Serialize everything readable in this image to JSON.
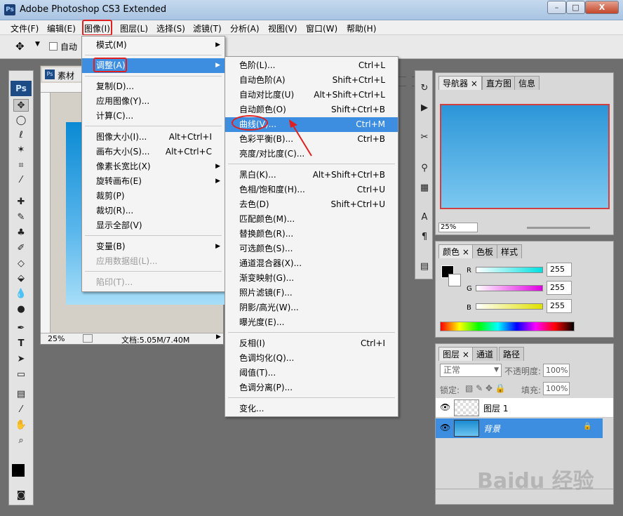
{
  "window": {
    "title": "Adobe Photoshop CS3 Extended",
    "minimize": "–",
    "maximize": "□",
    "close": "X"
  },
  "menubar": [
    "文件(F)",
    "编辑(E)",
    "图像(I)",
    "图层(L)",
    "选择(S)",
    "滤镜(T)",
    "分析(A)",
    "视图(V)",
    "窗口(W)",
    "帮助(H)"
  ],
  "options": {
    "auto_select": "自动",
    "ps_icon": "Ps"
  },
  "document": {
    "tab": "素材",
    "zoom": "25%",
    "filesize": "文档:5.05M/7.40M"
  },
  "image_menu": {
    "items": [
      {
        "label": "模式(M)",
        "sub": true
      },
      {
        "label": "调整(A)",
        "sub": true,
        "highlight": true
      },
      {
        "label": "复制(D)..."
      },
      {
        "label": "应用图像(Y)..."
      },
      {
        "label": "计算(C)..."
      },
      {
        "label": "图像大小(I)...",
        "shortcut": "Alt+Ctrl+I"
      },
      {
        "label": "画布大小(S)...",
        "shortcut": "Alt+Ctrl+C"
      },
      {
        "label": "像素长宽比(X)",
        "sub": true
      },
      {
        "label": "旋转画布(E)",
        "sub": true
      },
      {
        "label": "裁剪(P)"
      },
      {
        "label": "裁切(R)..."
      },
      {
        "label": "显示全部(V)"
      },
      {
        "label": "变量(B)",
        "sub": true
      },
      {
        "label": "应用数据组(L)...",
        "disabled": true
      },
      {
        "label": "陷印(T)...",
        "disabled": true
      }
    ]
  },
  "adjust_menu": {
    "items": [
      {
        "label": "色阶(L)...",
        "shortcut": "Ctrl+L"
      },
      {
        "label": "自动色阶(A)",
        "shortcut": "Shift+Ctrl+L"
      },
      {
        "label": "自动对比度(U)",
        "shortcut": "Alt+Shift+Ctrl+L"
      },
      {
        "label": "自动颜色(O)",
        "shortcut": "Shift+Ctrl+B"
      },
      {
        "label": "曲线(V)...",
        "shortcut": "Ctrl+M",
        "highlight": true
      },
      {
        "label": "色彩平衡(B)...",
        "shortcut": "Ctrl+B"
      },
      {
        "label": "亮度/对比度(C)..."
      },
      {
        "label": "黑白(K)...",
        "shortcut": "Alt+Shift+Ctrl+B"
      },
      {
        "label": "色相/饱和度(H)...",
        "shortcut": "Ctrl+U"
      },
      {
        "label": "去色(D)",
        "shortcut": "Shift+Ctrl+U"
      },
      {
        "label": "匹配颜色(M)..."
      },
      {
        "label": "替换颜色(R)..."
      },
      {
        "label": "可选颜色(S)..."
      },
      {
        "label": "通道混合器(X)..."
      },
      {
        "label": "渐变映射(G)..."
      },
      {
        "label": "照片滤镜(F)..."
      },
      {
        "label": "阴影/高光(W)..."
      },
      {
        "label": "曝光度(E)..."
      },
      {
        "label": "反相(I)",
        "shortcut": "Ctrl+I"
      },
      {
        "label": "色调均化(Q)..."
      },
      {
        "label": "阈值(T)..."
      },
      {
        "label": "色调分离(P)..."
      },
      {
        "label": "变化..."
      }
    ]
  },
  "navigator": {
    "tabs": [
      "导航器",
      "直方图",
      "信息"
    ],
    "zoom": "25%"
  },
  "color_panel": {
    "tabs": [
      "颜色",
      "色板",
      "样式"
    ],
    "r_label": "R",
    "g_label": "G",
    "b_label": "B",
    "r": "255",
    "g": "255",
    "b": "255"
  },
  "layers_panel": {
    "tabs": [
      "图层",
      "通道",
      "路径"
    ],
    "blend_mode": "正常",
    "opacity_label": "不透明度:",
    "opacity": "100%",
    "lock_label": "锁定:",
    "fill_label": "填充:",
    "fill": "100%",
    "layers": [
      {
        "name": "图层 1"
      },
      {
        "name": "背景"
      }
    ]
  },
  "watermark": "Baidu 经验",
  "colors": {
    "accent": "#3d8ee0",
    "annotation": "#e02020"
  }
}
